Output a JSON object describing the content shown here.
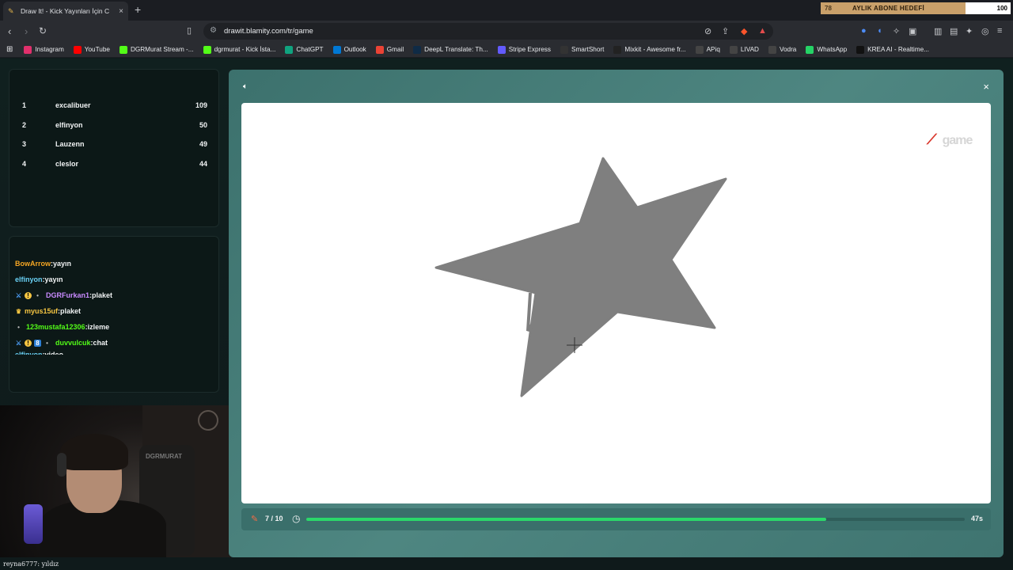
{
  "browser": {
    "tab_title": "Draw It! - Kick Yayınları İçin C",
    "goal_left": "78",
    "goal_label": "AYLIK ABONE HEDEFİ",
    "goal_right": "100",
    "url": "drawit.blamity.com/tr/game"
  },
  "bookmarks": [
    {
      "label": "Instagram",
      "color": "#e1306c"
    },
    {
      "label": "YouTube",
      "color": "#ff0000"
    },
    {
      "label": "DGRMurat Stream -...",
      "color": "#53fc18"
    },
    {
      "label": "dgrmurat - Kick İsta...",
      "color": "#53fc18"
    },
    {
      "label": "ChatGPT",
      "color": "#10a37f"
    },
    {
      "label": "Outlook",
      "color": "#0078d4"
    },
    {
      "label": "Gmail",
      "color": "#ea4335"
    },
    {
      "label": "DeepL Translate: Th...",
      "color": "#0f2b46"
    },
    {
      "label": "Stripe Express",
      "color": "#635bff"
    },
    {
      "label": "SmartShort",
      "color": "#333333"
    },
    {
      "label": "Mixkit - Awesome fr...",
      "color": "#222222"
    },
    {
      "label": "APiq",
      "color": "#444444"
    },
    {
      "label": "LIVAD",
      "color": "#444444"
    },
    {
      "label": "Vodra",
      "color": "#444444"
    },
    {
      "label": "WhatsApp",
      "color": "#25d366"
    },
    {
      "label": "KREA AI - Realtime...",
      "color": "#111111"
    }
  ],
  "leaderboard": [
    {
      "rank": "1",
      "name": "excalibuer",
      "score": "109"
    },
    {
      "rank": "2",
      "name": "elfinyon",
      "score": "50"
    },
    {
      "rank": "3",
      "name": "Lauzenn",
      "score": "49"
    },
    {
      "rank": "4",
      "name": "cleslor",
      "score": "44"
    }
  ],
  "chat": [
    {
      "user": "BowArrow",
      "text": "yayın",
      "color": "#f5a623",
      "badges": []
    },
    {
      "user": "elfinyon",
      "text": "yayın",
      "color": "#6ad1f5",
      "badges": []
    },
    {
      "user": "DGRFurkan1",
      "text": "plaket",
      "color": "#c98bff",
      "badges": [
        "sword",
        "coin",
        "dot"
      ]
    },
    {
      "user": "myus15uf",
      "text": "plaket",
      "color": "#f5c542",
      "badges": [
        "crown"
      ]
    },
    {
      "user": "123mustafa12306",
      "text": "izleme",
      "color": "#53fc18",
      "badges": [
        "dot"
      ]
    },
    {
      "user": "duvvulcuk",
      "text": "chat",
      "color": "#53fc18",
      "badges": [
        "sword",
        "coin",
        "sub",
        "dot"
      ]
    },
    {
      "user": "elfinyon",
      "text": "video",
      "color": "#6ad1f5",
      "badges": []
    }
  ],
  "webcam": {
    "chair_text": "DGRMURAT"
  },
  "caption": "reyna6777: yıldız",
  "game": {
    "brand_text": "game",
    "round": "7 / 10",
    "timer": "47s",
    "progress_pct": 79
  }
}
